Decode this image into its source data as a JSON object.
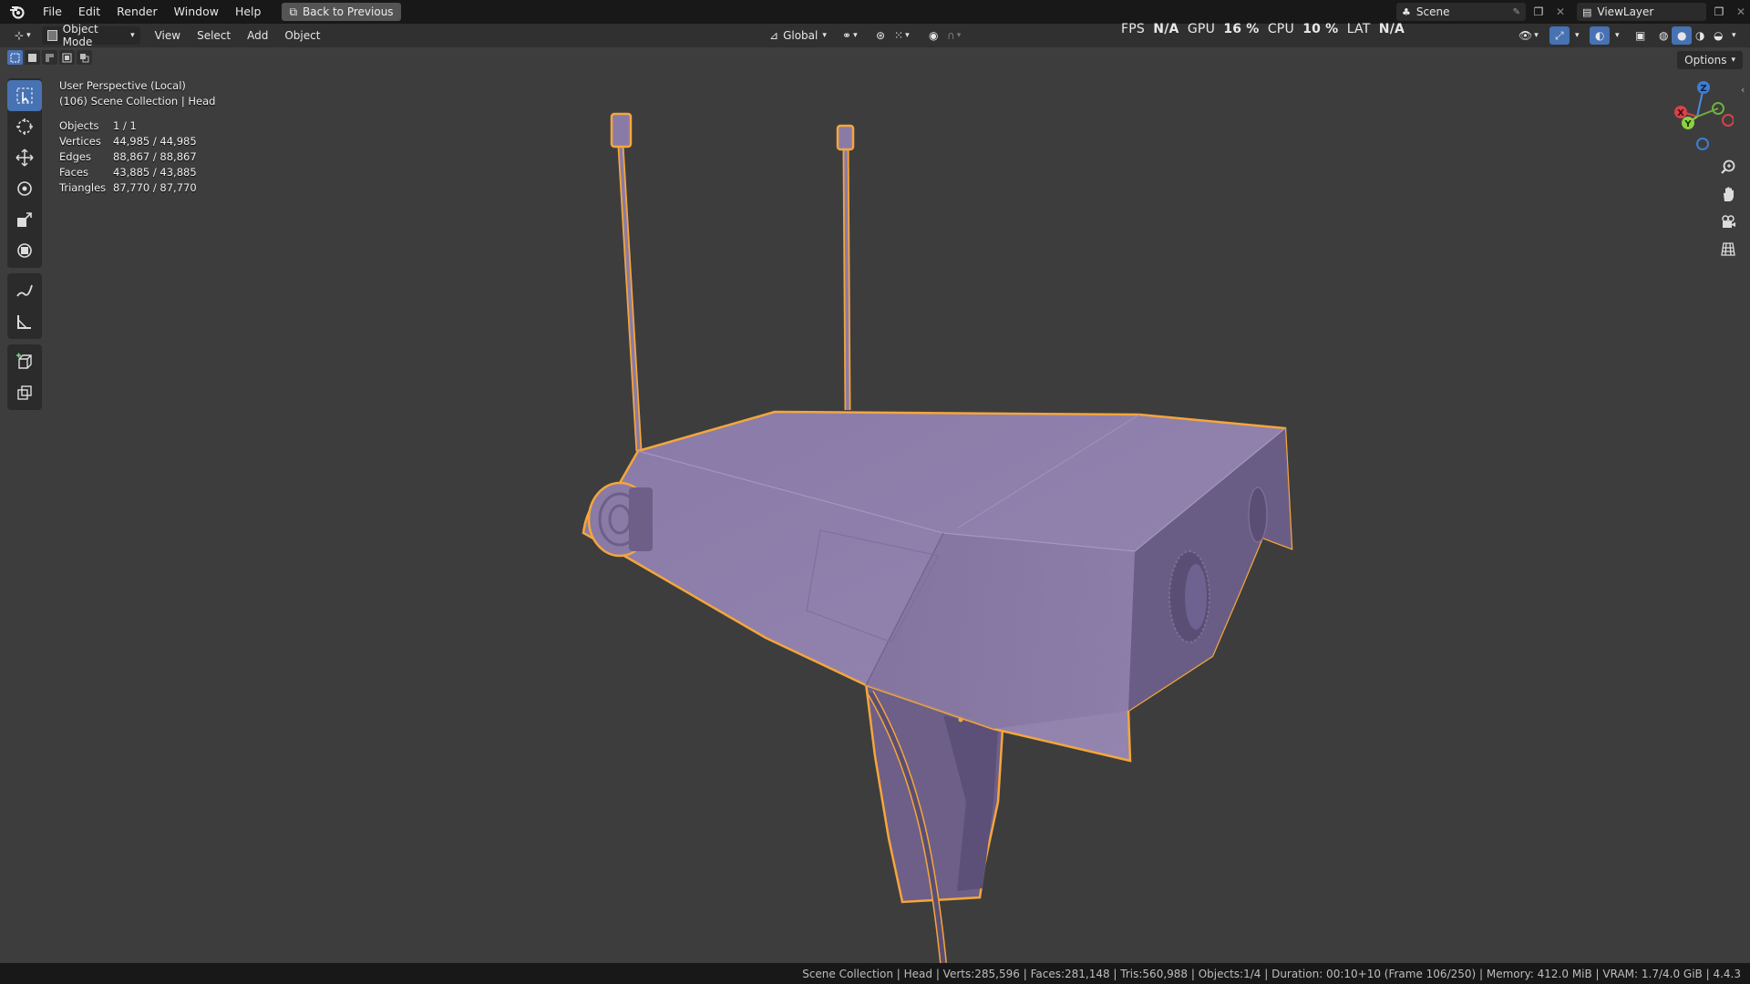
{
  "menubar": {
    "items": [
      "File",
      "Edit",
      "Render",
      "Window",
      "Help"
    ],
    "back_button": "Back to Previous",
    "scene": "Scene",
    "view_layer": "ViewLayer"
  },
  "header": {
    "mode": "Object Mode",
    "menus": [
      "View",
      "Select",
      "Add",
      "Object"
    ],
    "transform_orientation": "Global",
    "options": "Options"
  },
  "perf": {
    "fps_label": "FPS",
    "fps_value": "N/A",
    "gpu_label": "GPU",
    "gpu_value": "16 %",
    "cpu_label": "CPU",
    "cpu_value": "10 %",
    "lat_label": "LAT",
    "lat_value": "N/A"
  },
  "overlay": {
    "view_name": "User Perspective (Local)",
    "collection": "(106) Scene Collection | Head",
    "stats": [
      {
        "label": "Objects",
        "value": "1 / 1"
      },
      {
        "label": "Vertices",
        "value": "44,985 / 44,985"
      },
      {
        "label": "Edges",
        "value": "88,867 / 88,867"
      },
      {
        "label": "Faces",
        "value": "43,885 / 43,885"
      },
      {
        "label": "Triangles",
        "value": "87,770 / 87,770"
      }
    ]
  },
  "gizmo": {
    "x": "X",
    "y": "Y",
    "z": "Z"
  },
  "statusbar": {
    "text": "Scene Collection | Head | Verts:285,596 | Faces:281,148 | Tris:560,988 | Objects:1/4 | Duration: 00:10+10 (Frame 106/250) | Memory: 412.0 MiB | VRAM: 1.7/4.0 GiB | 4.4.3"
  },
  "colors": {
    "model_fill": "#8a7ba6",
    "outline": "#f5a63b",
    "active_tool": "#4772b3",
    "viewport_bg": "#3d3d3d"
  },
  "icons": [
    "blender-logo-icon",
    "select-box-icon",
    "cursor-icon",
    "move-icon",
    "rotate-icon",
    "scale-icon",
    "transform-icon",
    "annotate-icon",
    "measure-icon",
    "add-cube-icon",
    "extrude-icon",
    "zoom-icon",
    "hand-icon",
    "camera-icon",
    "grid-icon"
  ]
}
